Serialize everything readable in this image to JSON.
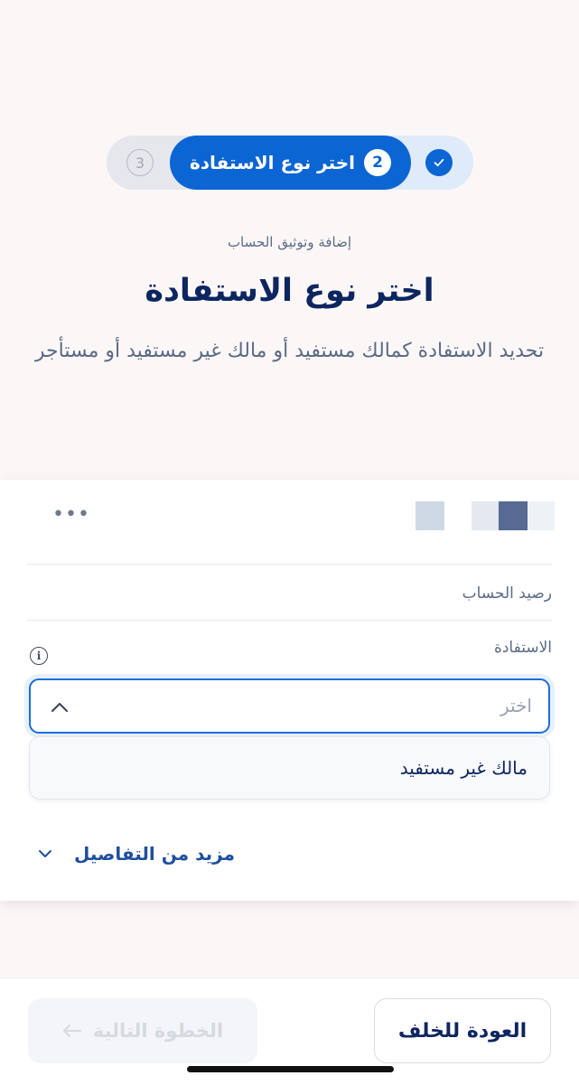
{
  "stepper": {
    "done_step": "check",
    "active_step_number": "2",
    "active_step_label": "اختر نوع الاستفادة",
    "pending_step_number": "3"
  },
  "header": {
    "subtitle": "إضافة وتوثيق الحساب",
    "title": "اختر نوع الاستفادة",
    "description": "تحديد الاستفادة كمالك مستفيد أو مالك غير مستفيد أو مستأجر"
  },
  "card": {
    "more_icon": "more-horizontal-icon",
    "balance_label": "رصيد الحساب",
    "benefit_label": "الاستفادة",
    "info_icon": "info-icon",
    "select_placeholder": "اختر",
    "dropdown_options": [
      "مالك غير مستفيد"
    ],
    "more_details_label": "مزيد من التفاصيل"
  },
  "footer": {
    "back_label": "العودة للخلف",
    "next_label": "الخطوة التالية",
    "next_disabled": true
  },
  "colors": {
    "primary": "#0b65d3",
    "title": "#0d2660",
    "muted": "#5a6b86",
    "background": "#fcf7f7"
  }
}
